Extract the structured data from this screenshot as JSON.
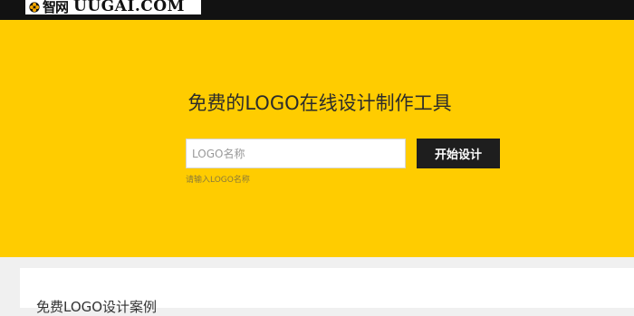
{
  "header": {
    "logo_cn": "智网",
    "logo_en": "UUGAI.COM",
    "logo_icon": "flower-icon",
    "logo_icon_color": "#f5a800",
    "background_color": "#121212"
  },
  "hero": {
    "title": "免费的LOGO在线设计制作工具",
    "input_placeholder": "LOGO名称",
    "input_value": "",
    "button_label": "开始设计",
    "hint": "请输入LOGO名称",
    "background_color": "#ffcc00"
  },
  "cases": {
    "title": "免费LOGO设计案例"
  }
}
